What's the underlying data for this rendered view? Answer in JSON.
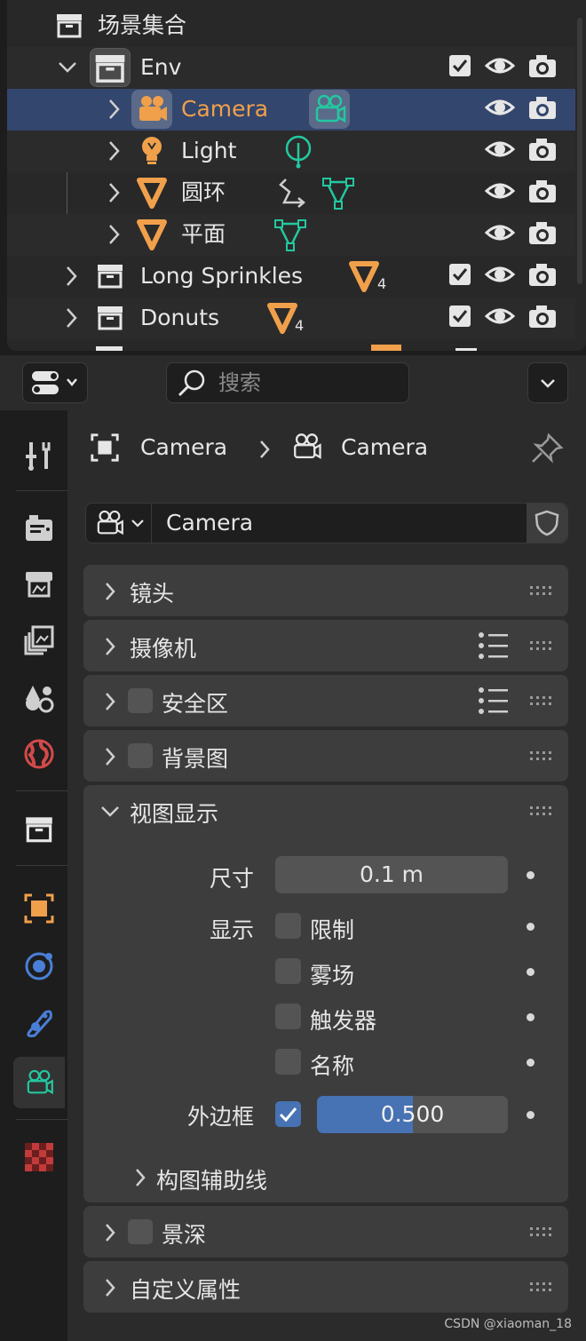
{
  "outliner": {
    "root_label": "场景集合",
    "rows": [
      {
        "label": "Env"
      },
      {
        "label": "Camera"
      },
      {
        "label": "Light"
      },
      {
        "label": "圆环"
      },
      {
        "label": "平面"
      },
      {
        "label": "Long Sprinkles",
        "count": "4"
      },
      {
        "label": "Donuts",
        "count": "4"
      }
    ]
  },
  "header": {
    "search_placeholder": "搜索"
  },
  "breadcrumb": {
    "object": "Camera",
    "data": "Camera"
  },
  "datablock": {
    "name": "Camera"
  },
  "panels": {
    "lens": "镜头",
    "camera": "摄像机",
    "safe_areas": "安全区",
    "background_images": "背景图",
    "viewport_display": "视图显示",
    "dof": "景深",
    "custom_props": "自定义属性"
  },
  "viewport_display": {
    "size_label": "尺寸",
    "size_value": "0.1 m",
    "show_label": "显示",
    "limits": "限制",
    "mist": "雾场",
    "sensor": "触发器",
    "name": "名称",
    "passepartout_label": "外边框",
    "passepartout_value": "0.500",
    "passepartout_fraction": 0.5,
    "composition_guides": "构图辅助线"
  },
  "watermark": "CSDN @xiaoman_18",
  "colors": {
    "accent": "#4772b3",
    "selected_row": "#33466d",
    "object_orange": "#f0a04b",
    "data_green": "#23c8a0"
  }
}
